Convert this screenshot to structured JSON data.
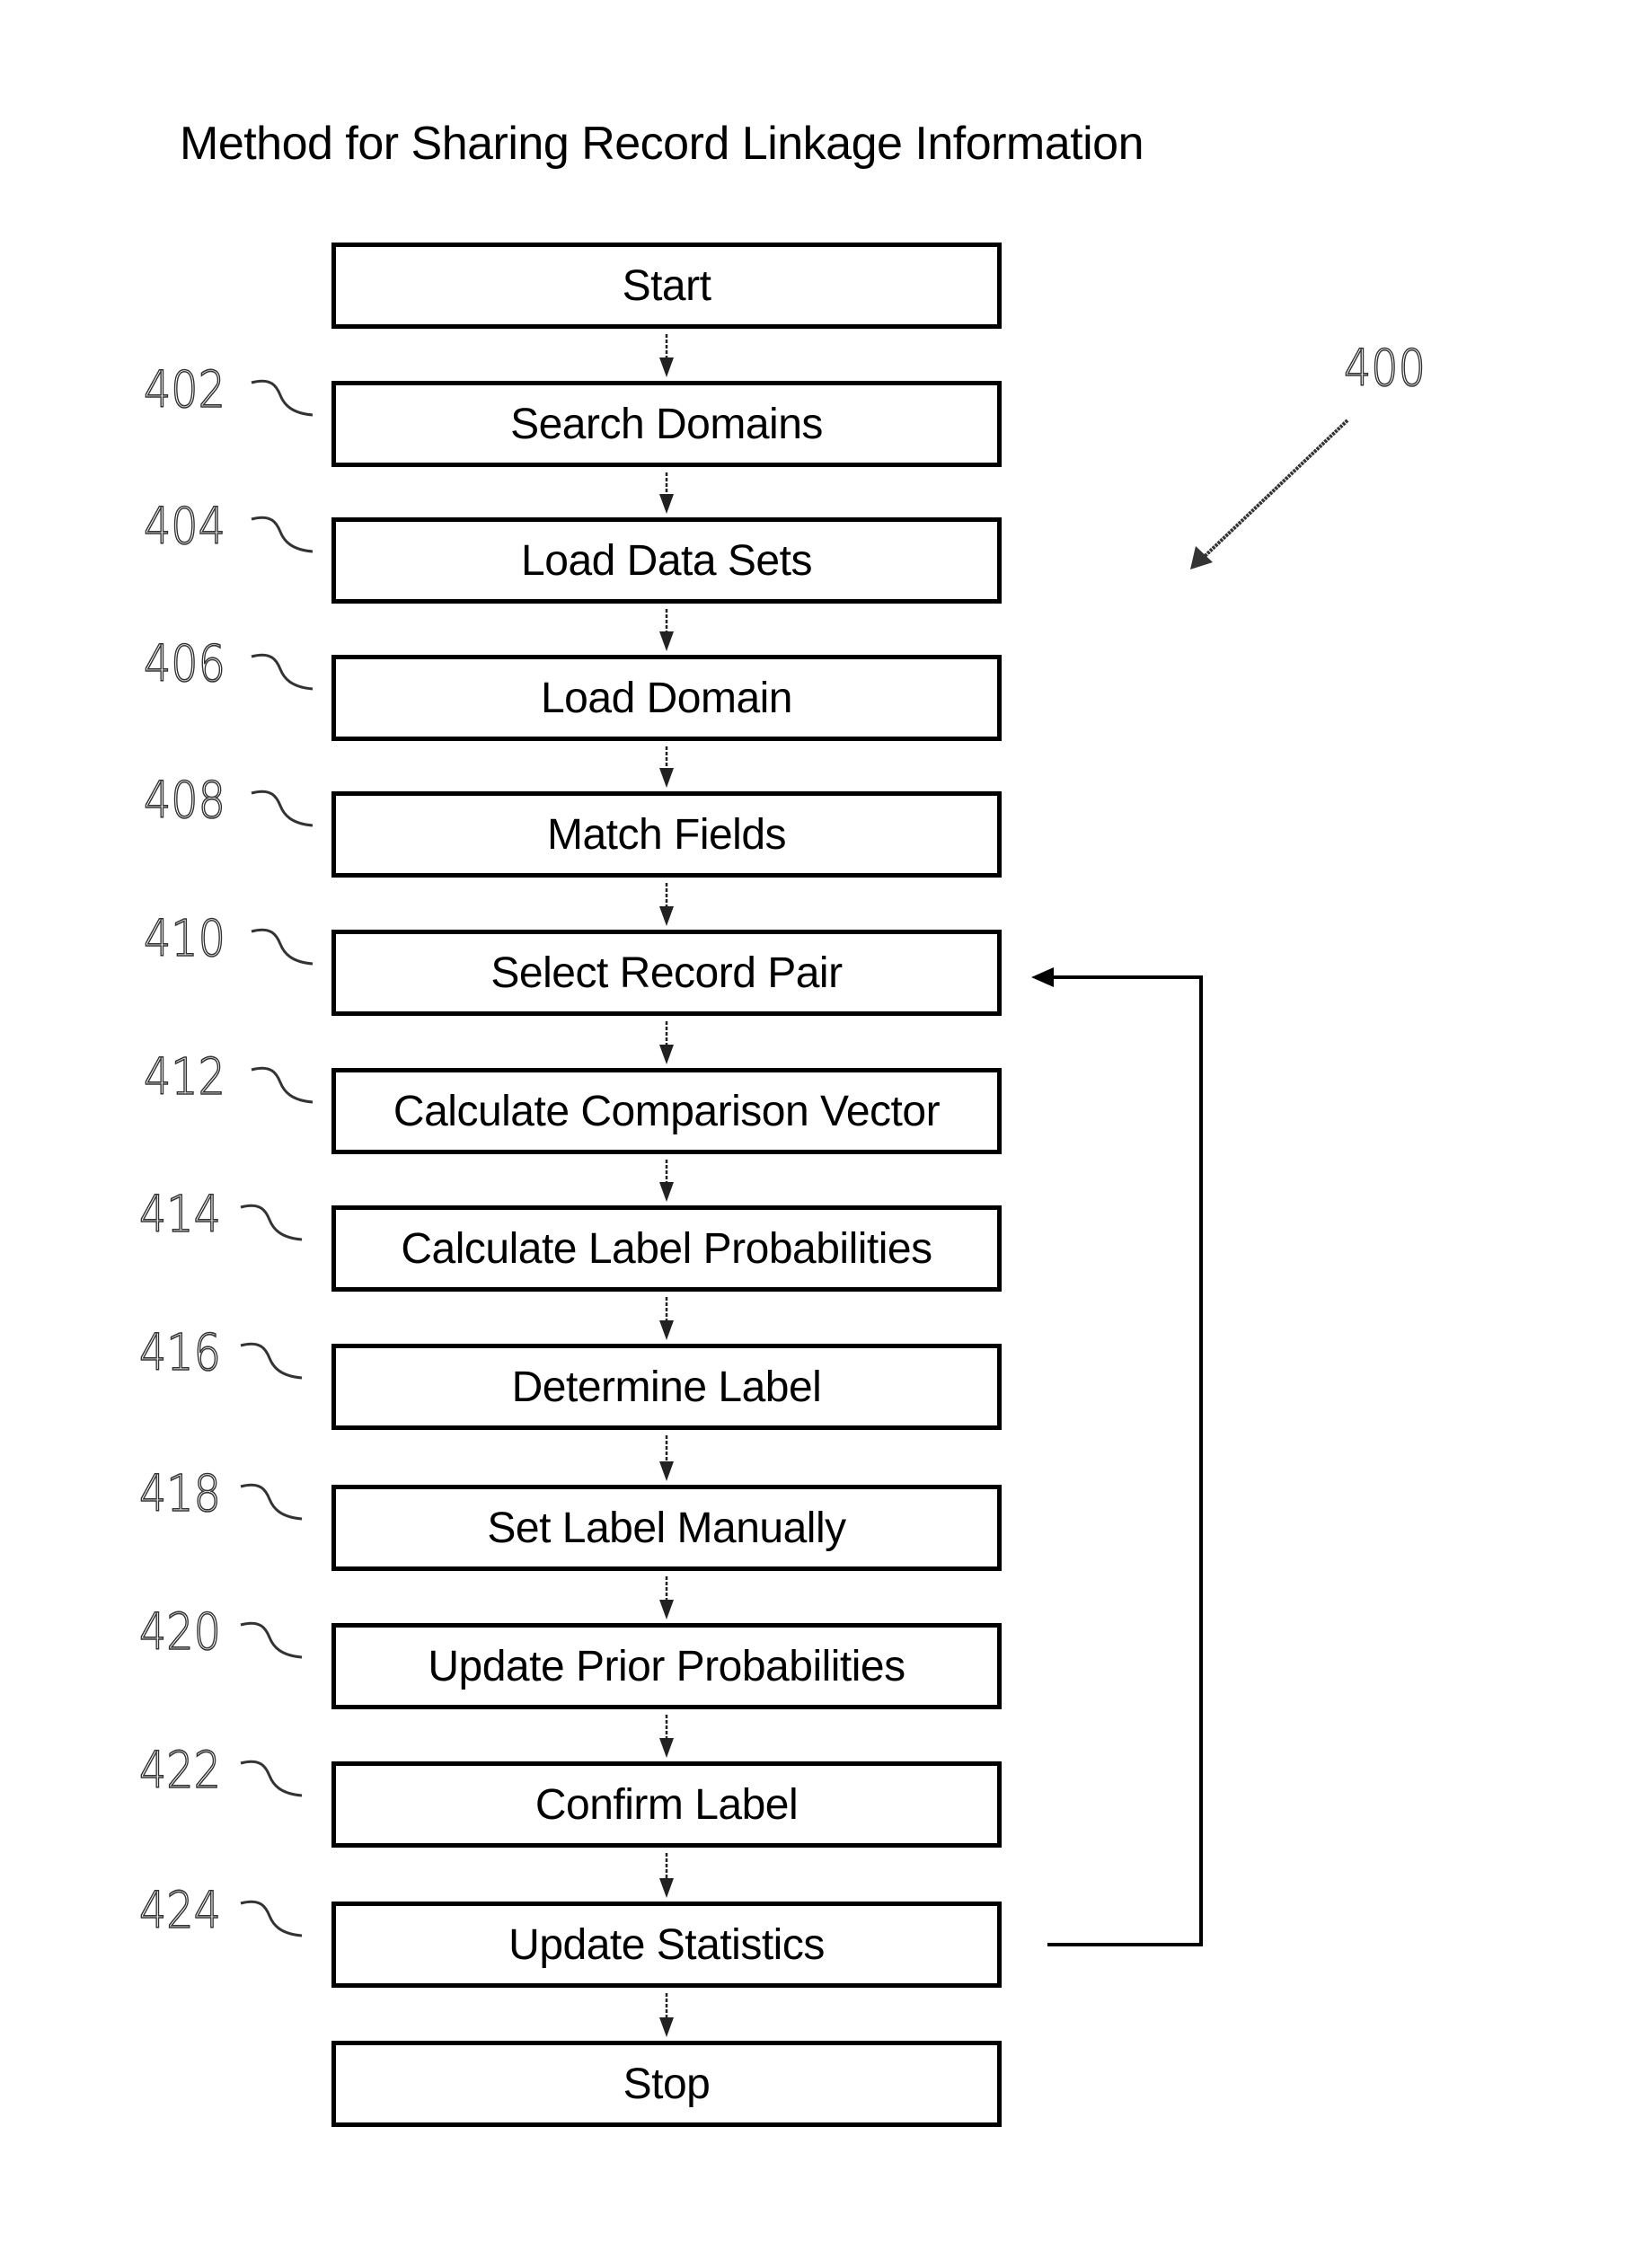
{
  "diagram": {
    "title": "Method for Sharing Record Linkage Information",
    "figure_ref": "400",
    "steps": [
      {
        "id": "start",
        "ref": "",
        "label": "Start"
      },
      {
        "id": "search-domains",
        "ref": "402",
        "label": "Search Domains"
      },
      {
        "id": "load-data-sets",
        "ref": "404",
        "label": "Load Data Sets"
      },
      {
        "id": "load-domain",
        "ref": "406",
        "label": "Load Domain"
      },
      {
        "id": "match-fields",
        "ref": "408",
        "label": "Match Fields"
      },
      {
        "id": "select-record-pair",
        "ref": "410",
        "label": "Select Record Pair"
      },
      {
        "id": "calculate-comparison-vector",
        "ref": "412",
        "label": "Calculate Comparison Vector"
      },
      {
        "id": "calculate-label-probabilities",
        "ref": "414",
        "label": "Calculate Label Probabilities"
      },
      {
        "id": "determine-label",
        "ref": "416",
        "label": "Determine Label"
      },
      {
        "id": "set-label-manually",
        "ref": "418",
        "label": "Set Label Manually"
      },
      {
        "id": "update-prior-probabilities",
        "ref": "420",
        "label": "Update Prior Probabilities"
      },
      {
        "id": "confirm-label",
        "ref": "422",
        "label": "Confirm Label"
      },
      {
        "id": "update-statistics",
        "ref": "424",
        "label": "Update Statistics"
      },
      {
        "id": "stop",
        "ref": "",
        "label": "Stop"
      }
    ],
    "edges": [
      {
        "from": "start",
        "to": "search-domains"
      },
      {
        "from": "search-domains",
        "to": "load-data-sets"
      },
      {
        "from": "load-data-sets",
        "to": "load-domain"
      },
      {
        "from": "load-domain",
        "to": "match-fields"
      },
      {
        "from": "match-fields",
        "to": "select-record-pair"
      },
      {
        "from": "select-record-pair",
        "to": "calculate-comparison-vector"
      },
      {
        "from": "calculate-comparison-vector",
        "to": "calculate-label-probabilities"
      },
      {
        "from": "calculate-label-probabilities",
        "to": "determine-label"
      },
      {
        "from": "determine-label",
        "to": "set-label-manually"
      },
      {
        "from": "set-label-manually",
        "to": "update-prior-probabilities"
      },
      {
        "from": "update-prior-probabilities",
        "to": "confirm-label"
      },
      {
        "from": "confirm-label",
        "to": "update-statistics"
      },
      {
        "from": "update-statistics",
        "to": "stop"
      }
    ],
    "loop_edge": {
      "from": "update-statistics",
      "to": "select-record-pair"
    }
  }
}
